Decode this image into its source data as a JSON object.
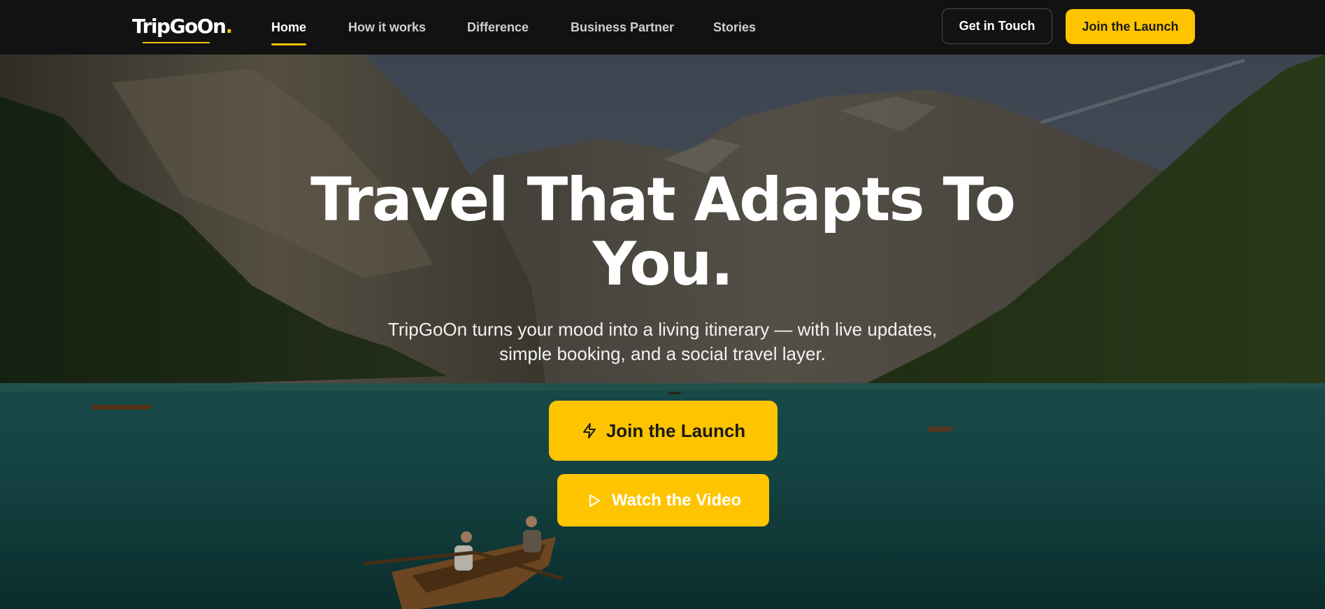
{
  "nav": {
    "logo": "TripGoOn",
    "logo_dot": ".",
    "links": [
      "Home",
      "How it works",
      "Difference",
      "Business Partner",
      "Stories"
    ],
    "active": "Home",
    "get_in_touch": "Get in Touch",
    "join_launch": "Join the Launch"
  },
  "hero": {
    "headline_line1": "Travel That Adapts To",
    "headline_line2": "You.",
    "sub_line1": "TripGoOn turns your mood into a living itinerary — with live updates,",
    "sub_line2": "simple booking, and a social travel layer.",
    "primary_cta": {
      "label": "Join the Launch",
      "icon": "lightning-icon"
    },
    "secondary_cta": {
      "label": "Watch the Video",
      "icon": "play-icon"
    },
    "background": "mountain-lake-photo"
  },
  "colors": {
    "accent": "#ffc400",
    "nav_bg": "#121212"
  }
}
